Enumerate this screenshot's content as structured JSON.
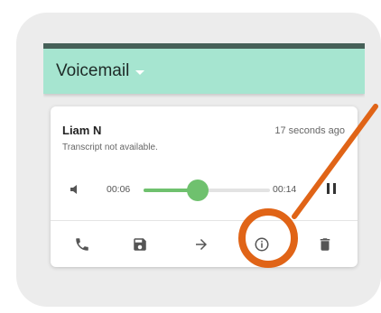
{
  "app": {
    "title": "Voicemail"
  },
  "voicemail": {
    "caller": "Liam N",
    "time_ago": "17 seconds ago",
    "transcript": "Transcript not available.",
    "player": {
      "current_time": "00:06",
      "total_time": "00:14",
      "progress_fraction": 0.43
    }
  },
  "actions": [
    {
      "icon": "phone-icon"
    },
    {
      "icon": "save-icon"
    },
    {
      "icon": "arrow-right-icon"
    },
    {
      "icon": "info-icon"
    },
    {
      "icon": "trash-icon"
    }
  ],
  "colors": {
    "appbar": "#a6e5d0",
    "slider": "#6fc16e",
    "highlight": "#e06417"
  }
}
